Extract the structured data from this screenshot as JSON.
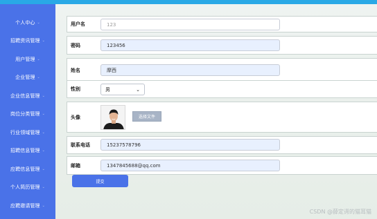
{
  "sidebar": {
    "items": [
      {
        "label": "个人中心"
      },
      {
        "label": "招聘资讯管理"
      },
      {
        "label": "用户管理"
      },
      {
        "label": "企业管理"
      },
      {
        "label": "企业信息管理"
      },
      {
        "label": "岗位分类管理"
      },
      {
        "label": "行业领域管理"
      },
      {
        "label": "招聘信息管理"
      },
      {
        "label": "应聘信息管理"
      },
      {
        "label": "个人简历管理"
      },
      {
        "label": "应聘邀请管理"
      }
    ]
  },
  "form": {
    "username": {
      "label": "用户名",
      "value": "123"
    },
    "password": {
      "label": "密码",
      "value": "123456"
    },
    "name": {
      "label": "姓名",
      "value": "摩西"
    },
    "gender": {
      "label": "性别",
      "value": "男"
    },
    "avatar": {
      "label": "头像",
      "button": "选择文件"
    },
    "phone": {
      "label": "联系电话",
      "value": "15237578796"
    },
    "email": {
      "label": "邮箱",
      "value": "1347845688@qq.com"
    },
    "submit": "提交"
  },
  "watermark": "CSDN @薛定谔的猫耳猫",
  "colors": {
    "sidebar": "#4a72e8",
    "topbar": "#29a9e6",
    "submit": "#4a72e8"
  }
}
